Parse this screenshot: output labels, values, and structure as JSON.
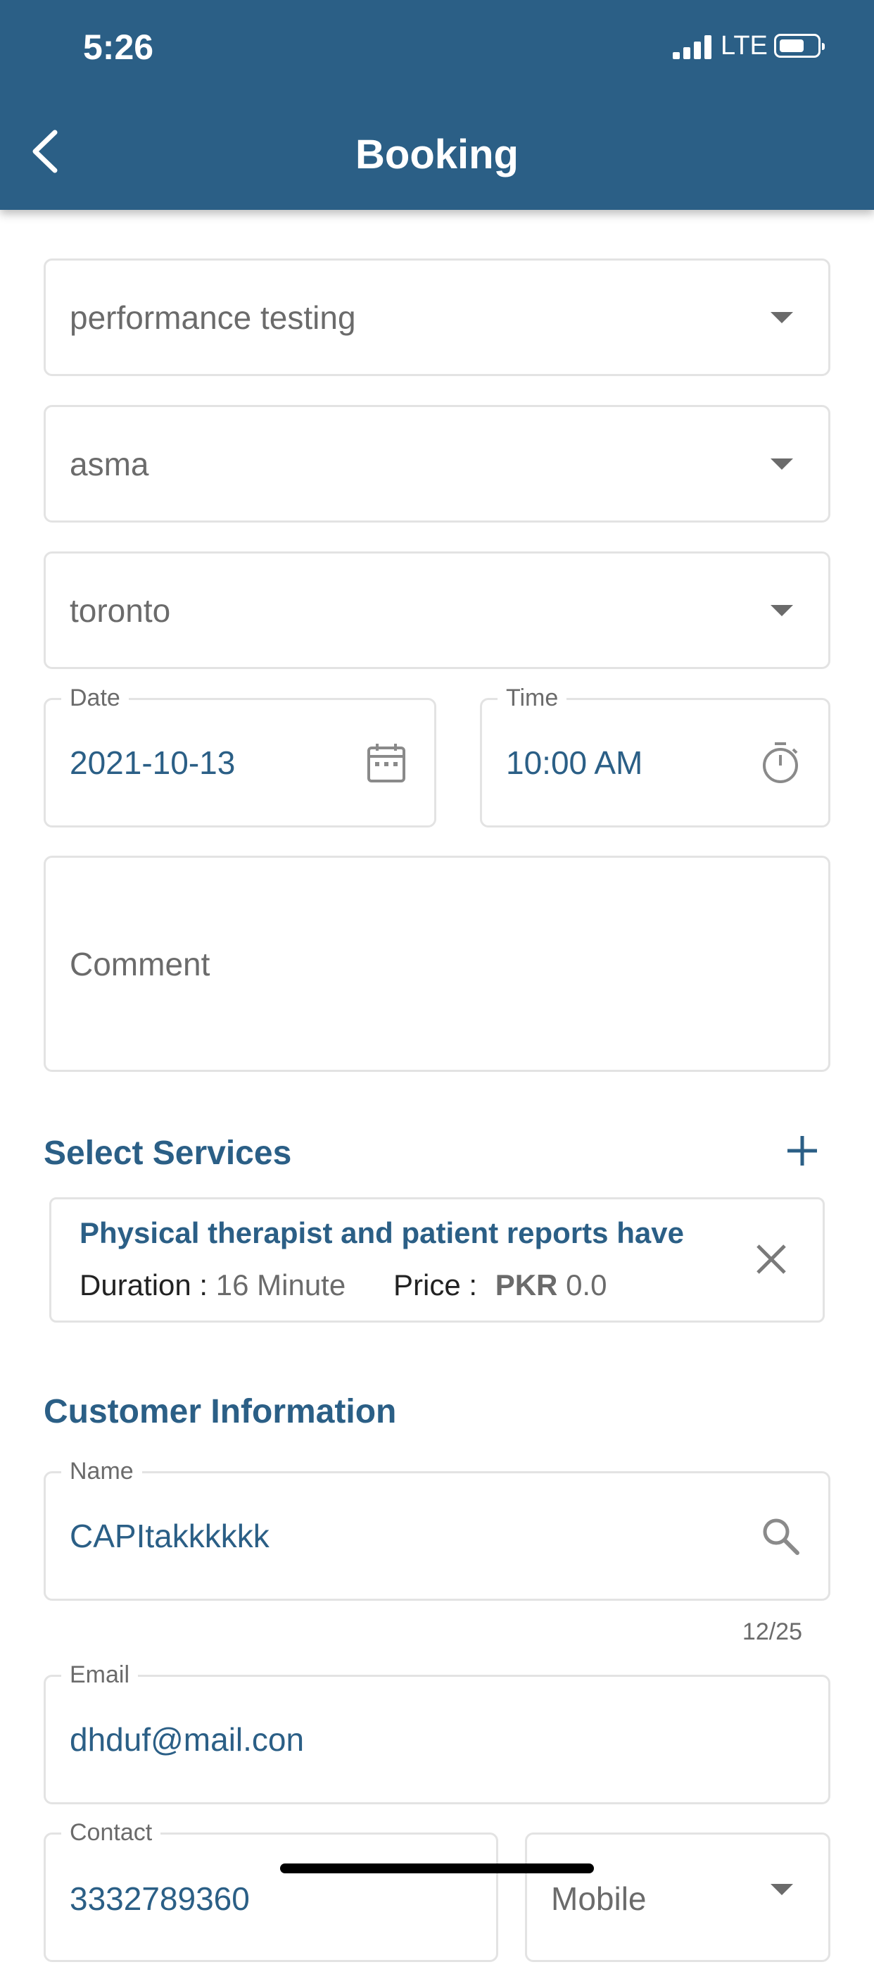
{
  "status_bar": {
    "time": "5:26",
    "network": "LTE"
  },
  "header": {
    "title": "Booking"
  },
  "form": {
    "service_category": "performance testing",
    "staff": "asma",
    "location": "toronto",
    "date": {
      "label": "Date",
      "value": "2021-10-13"
    },
    "time": {
      "label": "Time",
      "value": "10:00 AM"
    },
    "comment_placeholder": "Comment"
  },
  "services": {
    "title": "Select Services",
    "items": [
      {
        "name": "Physical therapist and patient reports have",
        "duration_label": "Duration :",
        "duration_value": "16 Minute",
        "price_label": "Price :",
        "currency": "PKR",
        "price_value": "0.0"
      }
    ]
  },
  "customer": {
    "title": "Customer Information",
    "name": {
      "label": "Name",
      "value": "CAPItakkkkkk",
      "counter": "12/25"
    },
    "email": {
      "label": "Email",
      "value": "dhduf@mail.con"
    },
    "contact": {
      "label": "Contact",
      "value": "3332789360",
      "type": "Mobile"
    }
  },
  "colors": {
    "primary": "#2b5f86",
    "border": "#e3e3e3",
    "muted_text": "#6b6b6b"
  },
  "icons": [
    "back-chevron-icon",
    "caret-down-icon",
    "calendar-icon",
    "stopwatch-icon",
    "plus-icon",
    "close-icon",
    "search-icon"
  ]
}
